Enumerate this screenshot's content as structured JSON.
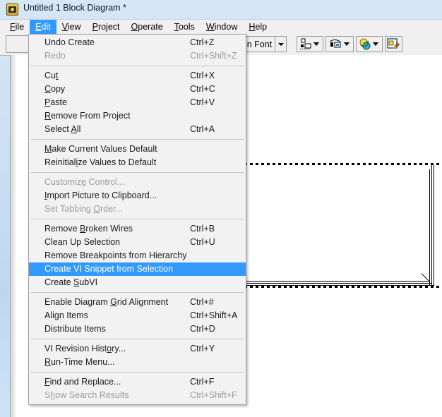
{
  "window": {
    "title": "Untitled 1 Block Diagram *",
    "icon": "labview-vi-icon"
  },
  "menubar": {
    "items": [
      {
        "label": "File",
        "mnemonic": "F",
        "active": false
      },
      {
        "label": "Edit",
        "mnemonic": "E",
        "active": true
      },
      {
        "label": "View",
        "mnemonic": "V",
        "active": false
      },
      {
        "label": "Project",
        "mnemonic": "P",
        "active": false
      },
      {
        "label": "Operate",
        "mnemonic": "O",
        "active": false
      },
      {
        "label": "Tools",
        "mnemonic": "T",
        "active": false
      },
      {
        "label": "Window",
        "mnemonic": "W",
        "active": false
      },
      {
        "label": "Help",
        "mnemonic": "H",
        "active": false
      }
    ]
  },
  "toolbar": {
    "font_selector_label": "ion Font",
    "buttons": [
      {
        "name": "align-objects-button",
        "title": "Align Objects"
      },
      {
        "name": "distribute-objects-button",
        "title": "Distribute Objects"
      },
      {
        "name": "reorder-button",
        "title": "Reorder"
      },
      {
        "name": "clean-up-diagram-button",
        "title": "Clean Up Diagram"
      }
    ]
  },
  "edit_menu": {
    "name": "Edit",
    "groups": [
      {
        "items": [
          {
            "label": "Undo Create",
            "accel": "Ctrl+Z",
            "disabled": false,
            "highlighted": false,
            "mnemonic_index": -1
          },
          {
            "label": "Redo",
            "accel": "Ctrl+Shift+Z",
            "disabled": true,
            "highlighted": false,
            "mnemonic_index": -1
          }
        ]
      },
      {
        "items": [
          {
            "label": "Cut",
            "accel": "Ctrl+X",
            "disabled": false,
            "highlighted": false,
            "mnemonic_index": 2
          },
          {
            "label": "Copy",
            "accel": "Ctrl+C",
            "disabled": false,
            "highlighted": false,
            "mnemonic_index": 0
          },
          {
            "label": "Paste",
            "accel": "Ctrl+V",
            "disabled": false,
            "highlighted": false,
            "mnemonic_index": 0
          },
          {
            "label": "Remove From Project",
            "accel": "",
            "disabled": false,
            "highlighted": false,
            "mnemonic_index": 0
          },
          {
            "label": "Select All",
            "accel": "Ctrl+A",
            "disabled": false,
            "highlighted": false,
            "mnemonic_index": 7
          }
        ]
      },
      {
        "items": [
          {
            "label": "Make Current Values Default",
            "accel": "",
            "disabled": false,
            "highlighted": false,
            "mnemonic_index": 0
          },
          {
            "label": "Reinitialize Values to Default",
            "accel": "",
            "disabled": false,
            "highlighted": false,
            "mnemonic_index": 9
          }
        ]
      },
      {
        "items": [
          {
            "label": "Customize Control...",
            "accel": "",
            "disabled": true,
            "highlighted": false,
            "mnemonic_index": 8
          },
          {
            "label": "Import Picture to Clipboard...",
            "accel": "",
            "disabled": false,
            "highlighted": false,
            "mnemonic_index": 0
          },
          {
            "label": "Set Tabbing Order...",
            "accel": "",
            "disabled": true,
            "highlighted": false,
            "mnemonic_index": 12
          }
        ]
      },
      {
        "items": [
          {
            "label": "Remove Broken Wires",
            "accel": "Ctrl+B",
            "disabled": false,
            "highlighted": false,
            "mnemonic_index": 7
          },
          {
            "label": "Clean Up Selection",
            "accel": "Ctrl+U",
            "disabled": false,
            "highlighted": false,
            "mnemonic_index": -1
          },
          {
            "label": "Remove Breakpoints from Hierarchy",
            "accel": "",
            "disabled": false,
            "highlighted": false,
            "mnemonic_index": -1
          },
          {
            "label": "Create VI Snippet from Selection",
            "accel": "",
            "disabled": false,
            "highlighted": true,
            "mnemonic_index": -1
          },
          {
            "label": "Create SubVI",
            "accel": "",
            "disabled": false,
            "highlighted": false,
            "mnemonic_index": 7
          }
        ]
      },
      {
        "items": [
          {
            "label": "Enable Diagram Grid Alignment",
            "accel": "Ctrl+#",
            "disabled": false,
            "highlighted": false,
            "mnemonic_index": 15
          },
          {
            "label": "Align Items",
            "accel": "Ctrl+Shift+A",
            "disabled": false,
            "highlighted": false,
            "mnemonic_index": -1
          },
          {
            "label": "Distribute Items",
            "accel": "Ctrl+D",
            "disabled": false,
            "highlighted": false,
            "mnemonic_index": -1
          }
        ]
      },
      {
        "items": [
          {
            "label": "VI Revision History...",
            "accel": "Ctrl+Y",
            "disabled": false,
            "highlighted": false,
            "mnemonic_index": 16
          },
          {
            "label": "Run-Time Menu...",
            "accel": "",
            "disabled": false,
            "highlighted": false,
            "mnemonic_index": 0
          }
        ]
      },
      {
        "items": [
          {
            "label": "Find and Replace...",
            "accel": "Ctrl+F",
            "disabled": false,
            "highlighted": false,
            "mnemonic_index": 0
          },
          {
            "label": "Show Search Results",
            "accel": "Ctrl+Shift+F",
            "disabled": true,
            "highlighted": false,
            "mnemonic_index": 1
          }
        ]
      }
    ]
  },
  "diagram": {
    "selection": "structure-selected",
    "structure_type": "flat-sequence-structure"
  },
  "colors": {
    "menu_highlight": "#3399ff",
    "menu_background": "#f2f2f2",
    "toolbar_background": "#f0f0f0",
    "title_gradient_top": "#d7e6f5",
    "disabled_text": "#9d9d9d"
  }
}
